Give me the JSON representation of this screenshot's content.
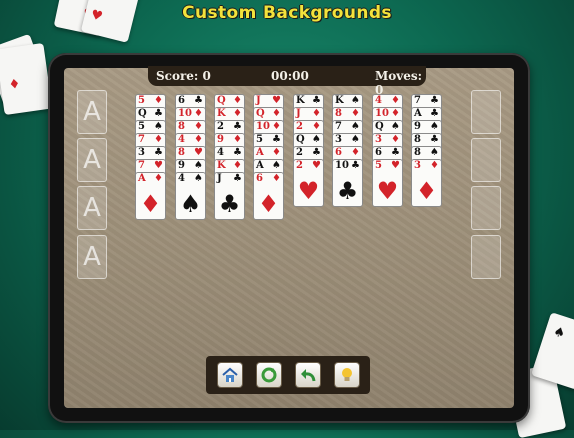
{
  "promo": {
    "title": "Custom Backgrounds"
  },
  "hud": {
    "score_label": "Score: 0",
    "time": "00:00",
    "moves_label": "Moves: 0"
  },
  "foundation_placeholder": "A",
  "foundations": [
    "A",
    "A",
    "A",
    "A"
  ],
  "columns": [
    [
      "5♦",
      "Q♣",
      "5♠",
      "7♦",
      "3♣",
      "7♥",
      "A♦"
    ],
    [
      "6♣",
      "10♦",
      "8♦",
      "4♦",
      "8♥",
      "9♠",
      "4♠"
    ],
    [
      "Q♦",
      "K♦",
      "2♣",
      "9♦",
      "4♣",
      "K♦",
      "J♣"
    ],
    [
      "J♥",
      "Q♦",
      "10♦",
      "5♣",
      "A♦",
      "A♠",
      "6♦"
    ],
    [
      "K♣",
      "J♦",
      "2♦",
      "Q♠",
      "2♣",
      "2♥"
    ],
    [
      "K♠",
      "8♦",
      "7♠",
      "3♠",
      "6♦",
      "10♣"
    ],
    [
      "4♦",
      "10♦",
      "Q♠",
      "3♦",
      "6♣",
      "5♥"
    ],
    [
      "7♣",
      "A♣",
      "9♠",
      "8♣",
      "8♠",
      "3♦"
    ]
  ],
  "toolbar": {
    "home": "home-icon",
    "restart": "restart-icon",
    "undo": "undo-icon",
    "hint": "hint-bulb-icon"
  },
  "colors": {
    "title": "#f2e23c",
    "felt": "#a89a84",
    "red_suit": "#d3232a",
    "panel": "#2a2117"
  }
}
